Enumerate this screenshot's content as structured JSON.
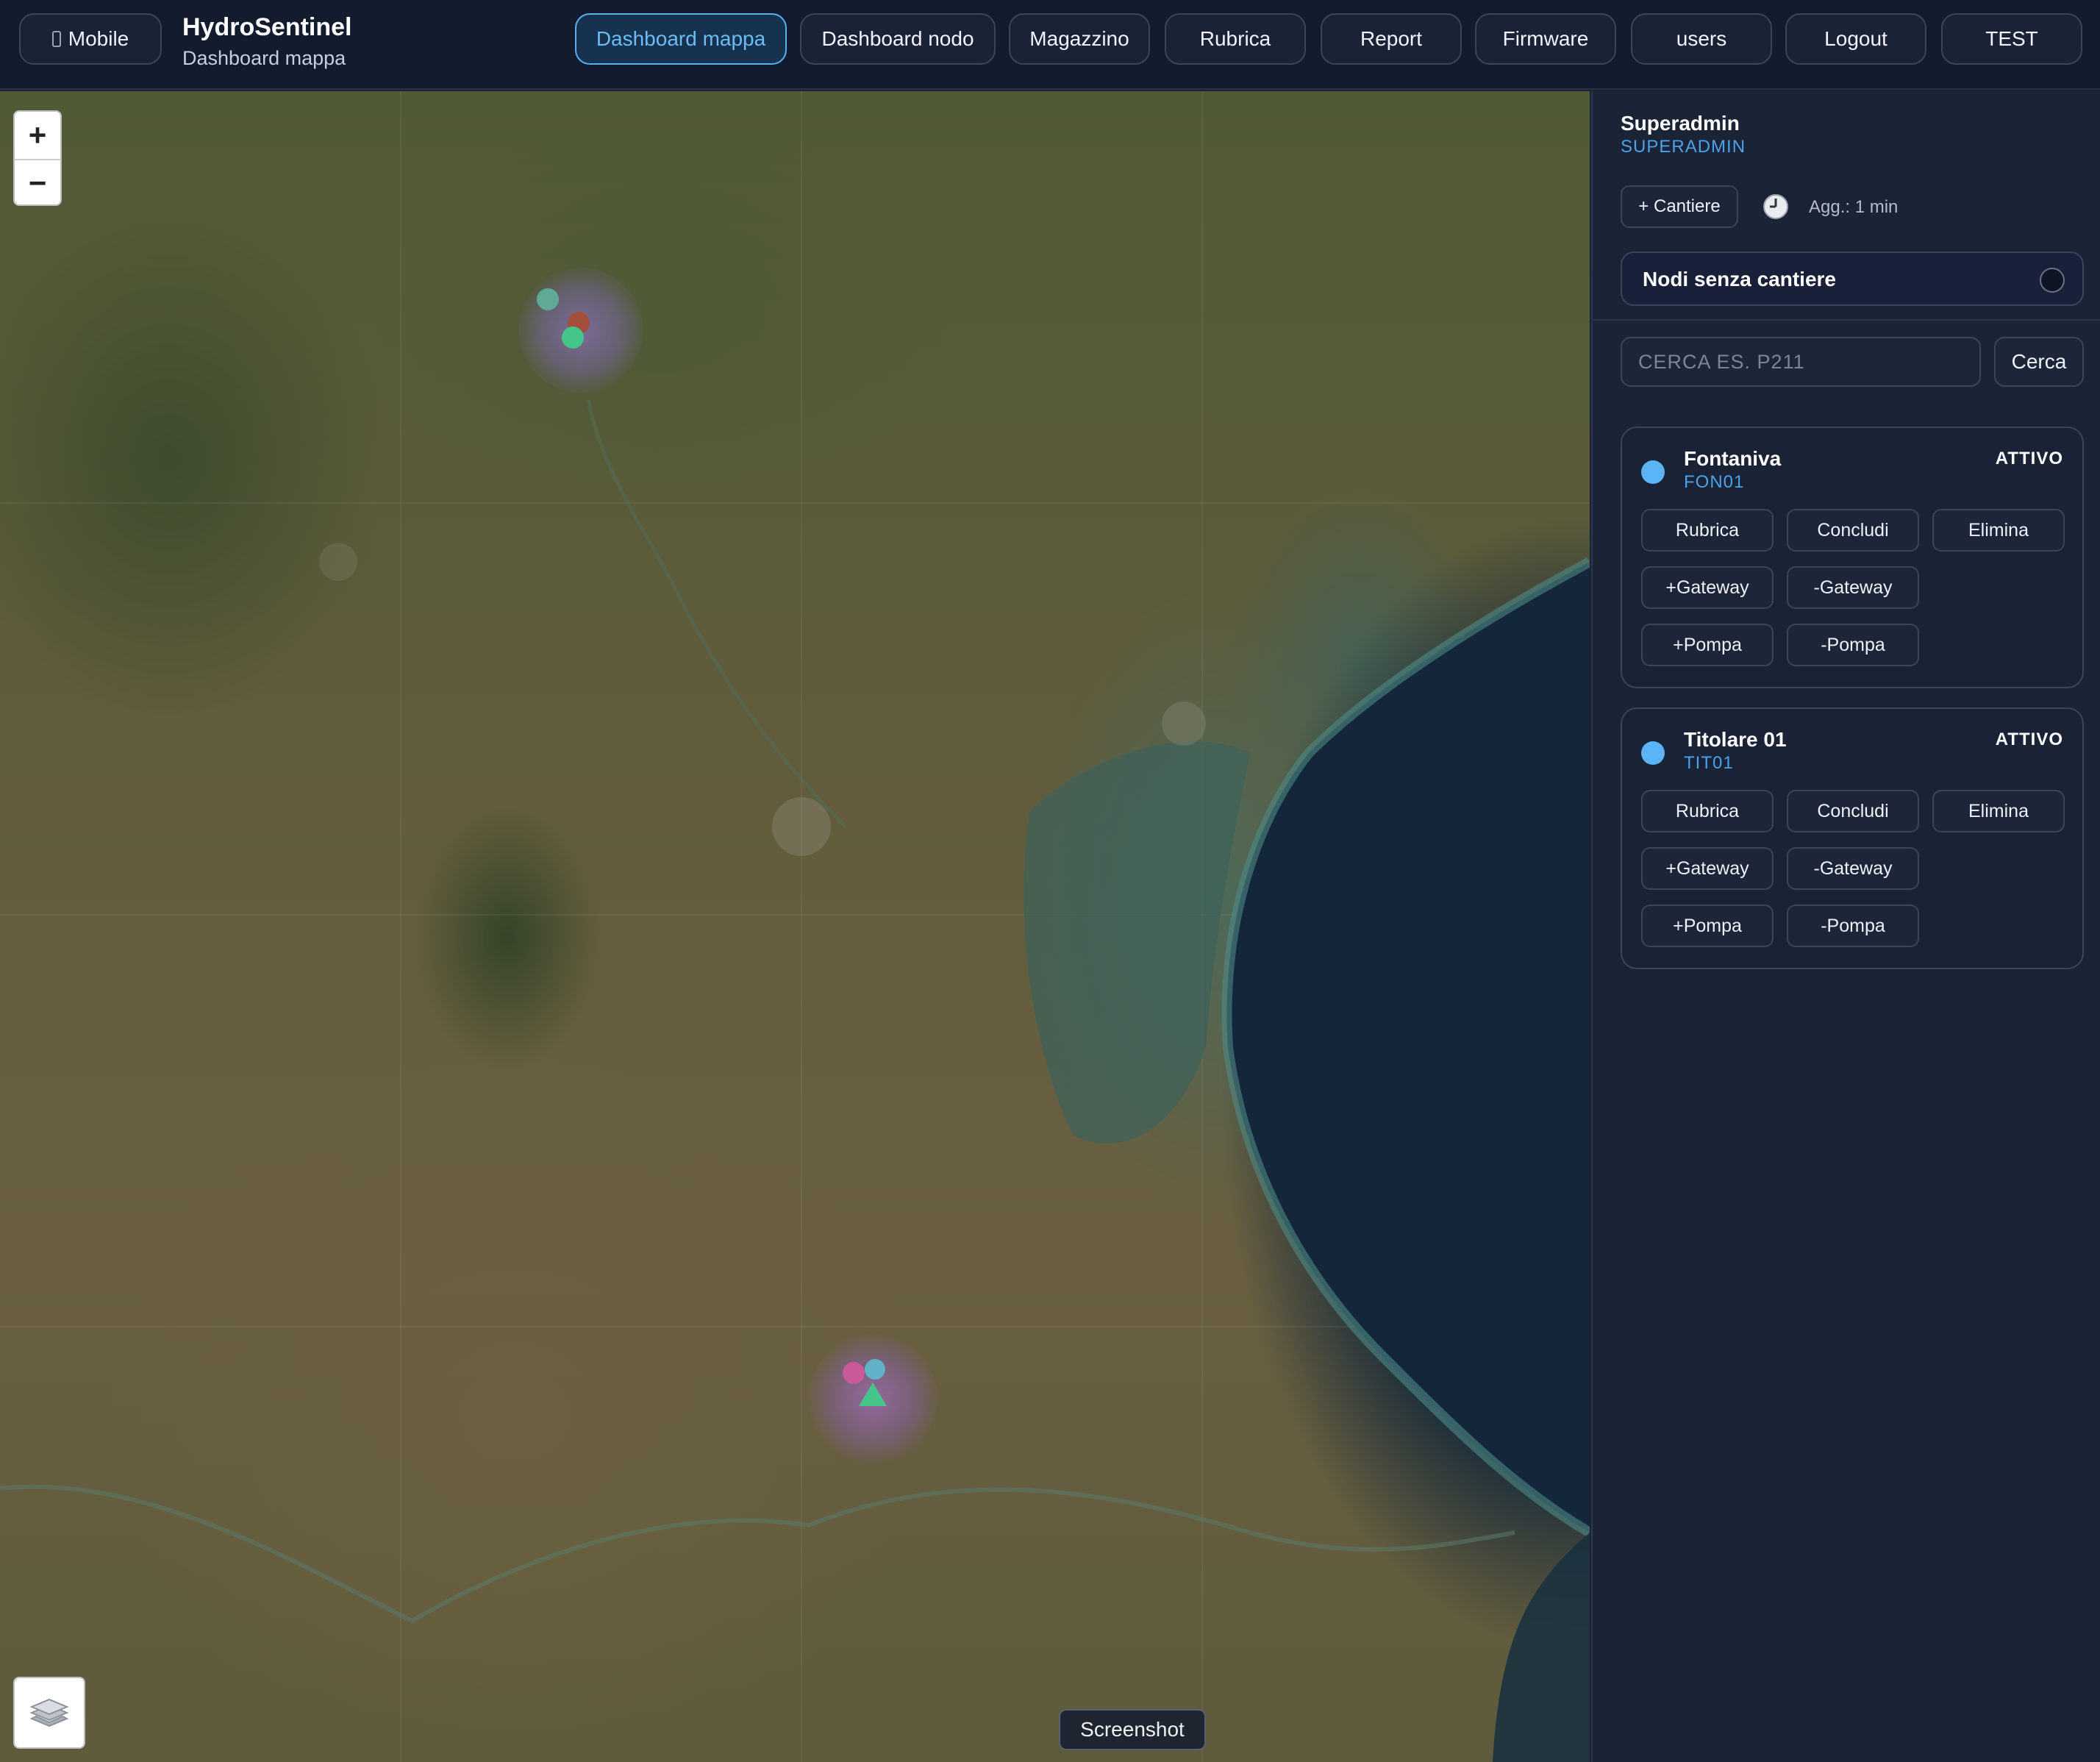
{
  "header": {
    "mobile_label": "Mobile",
    "app_title": "HydroSentinel",
    "app_subtitle": "Dashboard mappa",
    "nav": [
      {
        "label": "Dashboard mappa",
        "active": true
      },
      {
        "label": "Dashboard nodo",
        "active": false
      },
      {
        "label": "Magazzino",
        "active": false
      },
      {
        "label": "Rubrica",
        "active": false
      },
      {
        "label": "Report",
        "active": false
      },
      {
        "label": "Firmware",
        "active": false
      },
      {
        "label": "users",
        "active": false
      },
      {
        "label": "Logout",
        "active": false
      },
      {
        "label": "TEST",
        "active": false
      }
    ]
  },
  "map": {
    "zoom_in": "+",
    "zoom_out": "−",
    "screenshot_label": "Screenshot",
    "layers_icon": "layers-icon"
  },
  "sidebar": {
    "user_name": "Superadmin",
    "user_role": "SUPERADMIN",
    "add_site_label": "+ Cantiere",
    "refresh_text": "Agg.: 1 min",
    "nodes_without_site_label": "Nodi senza cantiere",
    "search_placeholder": "CERCA ES. P211",
    "search_button": "Cerca",
    "sites": [
      {
        "name": "Fontaniva",
        "code": "FON01",
        "status": "ATTIVO",
        "buttons": [
          "Rubrica",
          "Concludi",
          "Elimina",
          "+Gateway",
          "-Gateway",
          "+Pompa",
          "-Pompa"
        ]
      },
      {
        "name": "Titolare 01",
        "code": "TIT01",
        "status": "ATTIVO",
        "buttons": [
          "Rubrica",
          "Concludi",
          "Elimina",
          "+Gateway",
          "-Gateway",
          "+Pompa",
          "-Pompa"
        ]
      }
    ]
  },
  "colors": {
    "accent": "#5ab0f0",
    "status_dot": "#5ab4f5",
    "code_text": "#4aa3ea"
  }
}
